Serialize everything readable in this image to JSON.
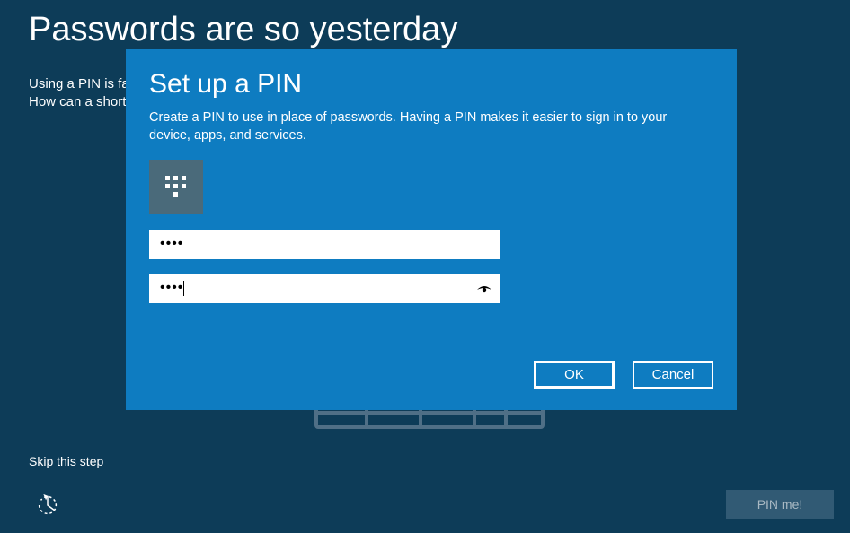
{
  "background": {
    "title": "Passwords are so yesterday",
    "line1": "Using a PIN is fa",
    "line2": "How can a short",
    "skip_label": "Skip this step",
    "pinme_label": "PIN me!"
  },
  "dialog": {
    "title": "Set up a PIN",
    "description": "Create a PIN to use in place of passwords. Having a PIN makes it easier to sign in to your device, apps, and services.",
    "pin_value_mask": "••••",
    "confirm_value_mask": "••••",
    "ok_label": "OK",
    "cancel_label": "Cancel"
  },
  "colors": {
    "page_bg": "#0d3c58",
    "dialog_bg": "#0e7cc1",
    "keypad_bg": "#4a6a7a",
    "disabled_btn_bg": "#315a74",
    "disabled_btn_fg": "#a9b9c3"
  }
}
